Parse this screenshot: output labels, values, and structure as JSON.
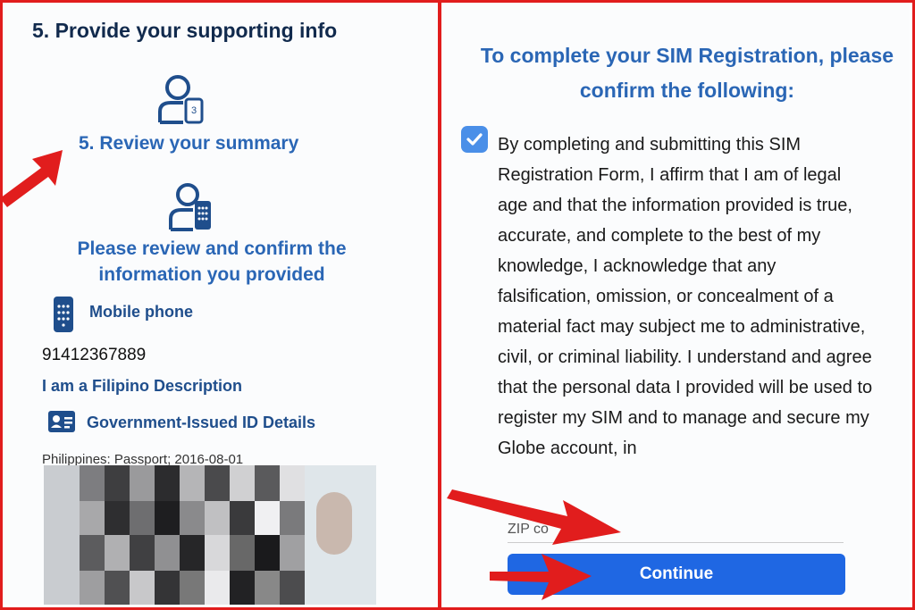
{
  "left_panel": {
    "step5_heading": "5. Provide your supporting info",
    "step_current": "5. Review your summary",
    "review_title": "Please review and confirm the information you provided",
    "mobile_label": "Mobile phone",
    "mobile_number": "91412367889",
    "filipino_description": "I am a Filipino Description",
    "gov_id_label": "Government-Issued ID Details",
    "id_details": "Philippines: Passport; 2016-08-01"
  },
  "right_panel": {
    "confirm_title": "To complete your SIM Registration, please confirm the following:",
    "checkbox_checked": true,
    "agreement_text": "By completing and submitting this SIM Registration Form, I affirm that I am of legal age and that the information provided is true, accurate, and complete to the best of my knowledge, I acknowledge that any falsification, omission, or concealment of a material fact may subject me to administrative, civil, or criminal liability. I understand and agree that the personal data I provided will be used to register my SIM and to manage and secure my Globe account, in",
    "zip_label": "ZIP co",
    "continue_label": "Continue"
  },
  "colors": {
    "frame": "#e11d1d",
    "accent": "#2a66b5",
    "button": "#1f67e3",
    "arrow": "#e11d1d"
  },
  "icons": [
    "user-step-icon",
    "user-phone-icon",
    "mobile-phone-icon",
    "id-card-icon",
    "checkmark-icon",
    "red-arrow-icon"
  ]
}
